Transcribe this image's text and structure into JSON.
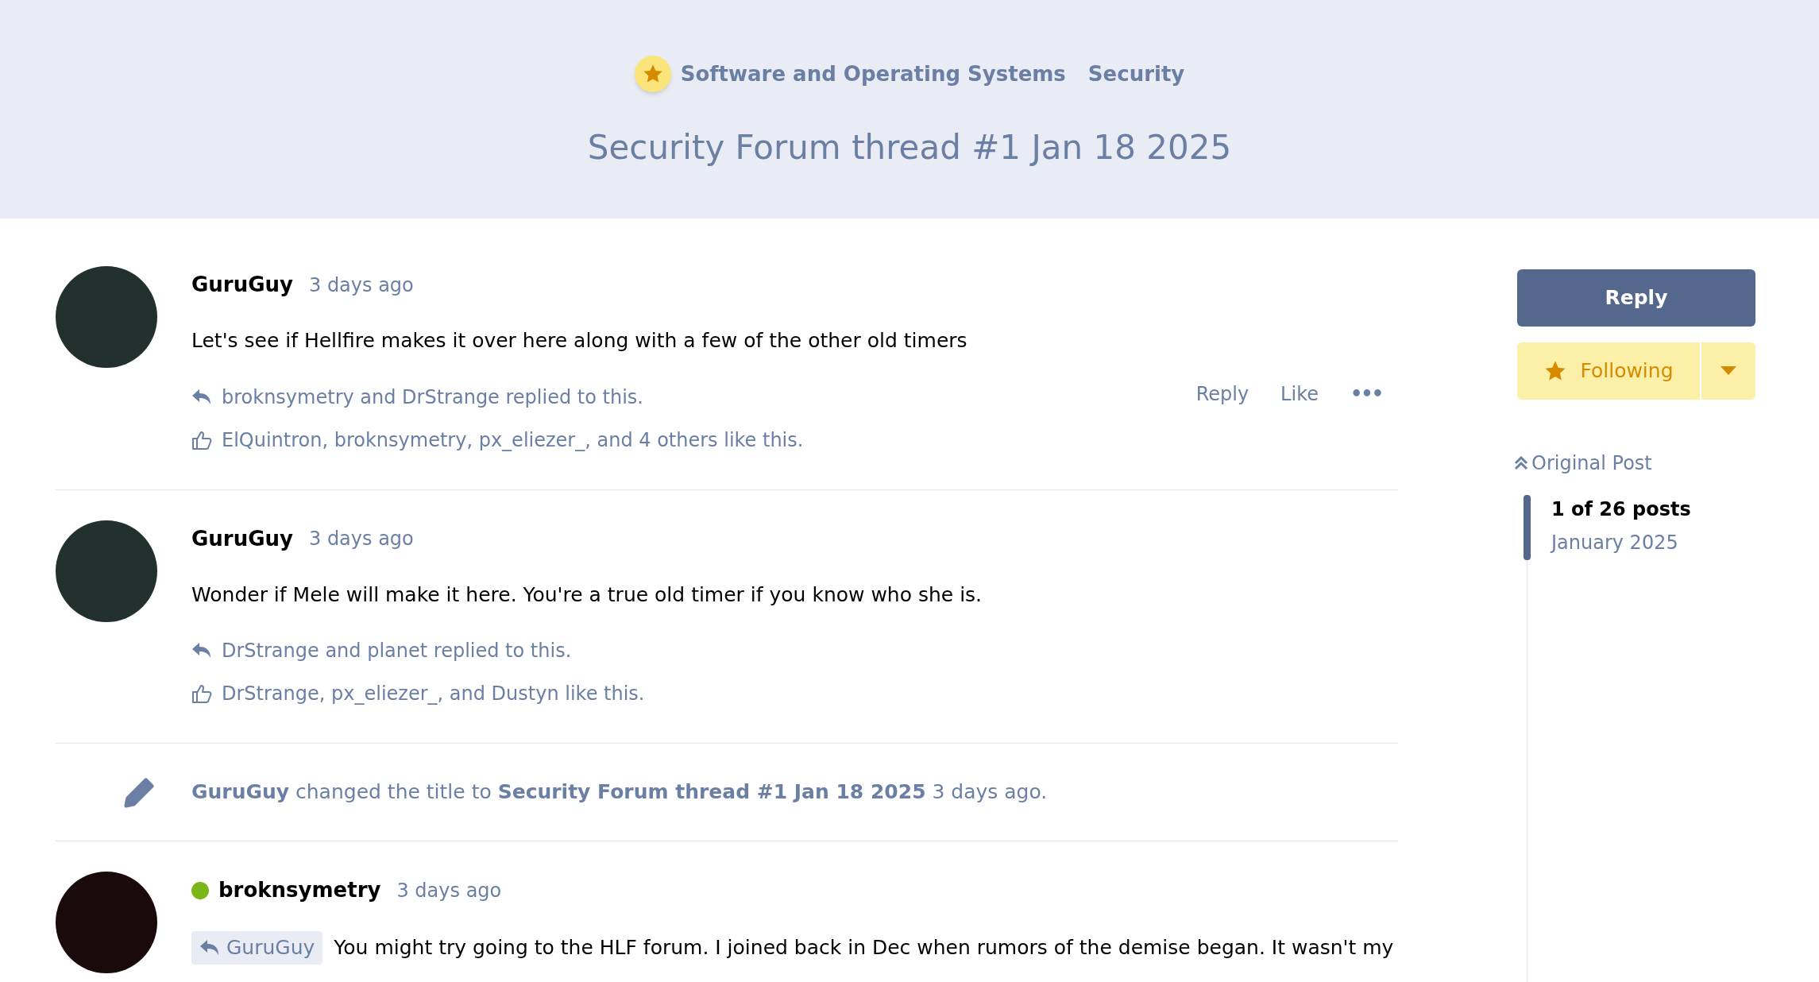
{
  "header": {
    "category": "Software and Operating Systems",
    "subcategory": "Security",
    "title": "Security Forum thread #1 Jan 18 2025"
  },
  "posts": [
    {
      "kind": "post",
      "author": "GuruGuy",
      "online": false,
      "time": "3 days ago",
      "body": "Let's see if Hellfire makes it over here along with a few of the other old timers",
      "replies": "broknsymetry and DrStrange replied to this.",
      "likes": "ElQuintron, broknsymetry, px_eliezer_, and 4 others like this.",
      "actions": [
        "Reply",
        "Like",
        "•••"
      ]
    },
    {
      "kind": "post",
      "author": "GuruGuy",
      "online": false,
      "time": "3 days ago",
      "body": "Wonder if Mele will make it here. You're a true old timer if you know who she is.",
      "replies": "DrStrange and planet replied to this.",
      "likes": "DrStrange, px_eliezer_, and Dustyn like this."
    },
    {
      "kind": "event",
      "text": "**GuruGuy** changed the title to **Security Forum thread #1 Jan 18 2025** 3 days ago."
    },
    {
      "kind": "post",
      "author": "broknsymetry",
      "online": true,
      "time": "3 days ago",
      "reply_to": "GuruGuy",
      "body": "You might try going to the HLF forum. I joined back in Dec when rumors of the demise began. It wasn't my"
    }
  ],
  "sidebar": {
    "reply_button": "Reply",
    "follow_button": "Following",
    "following": true,
    "original_post": "Original Post",
    "position": "1 of 26 posts",
    "date": "January 2025"
  }
}
